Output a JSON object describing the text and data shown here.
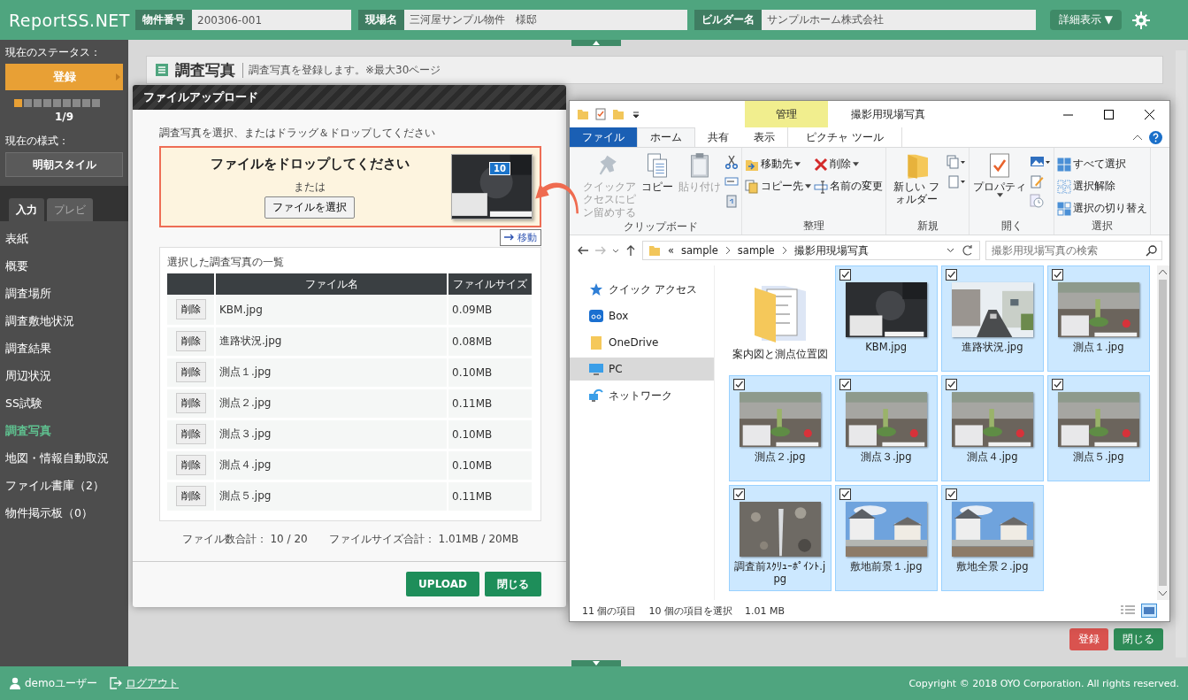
{
  "header": {
    "logo": "ReportSS.NET",
    "fields": [
      {
        "label": "物件番号",
        "value": "200306-001"
      },
      {
        "label": "現場名",
        "value": "三河屋サンプル物件　様邸"
      },
      {
        "label": "ビルダー名",
        "value": "サンプルホーム株式会社"
      }
    ],
    "detail_button": "詳細表示 ▼"
  },
  "sidebar": {
    "status_label": "現在のステータス：",
    "status": "登録",
    "steps": [
      {
        "done": true
      },
      {
        "done": false
      },
      {
        "done": false
      },
      {
        "done": false
      },
      {
        "done": false
      },
      {
        "done": false
      },
      {
        "done": false
      },
      {
        "done": false
      },
      {
        "done": false
      }
    ],
    "step_count": "1/9",
    "style_label": "現在の様式：",
    "style": "明朝スタイル",
    "tabs": [
      {
        "label": "入力",
        "selected": true
      },
      {
        "label": "プレビ",
        "selected": false
      }
    ],
    "items": [
      {
        "label": "表紙",
        "selected": false
      },
      {
        "label": "概要",
        "selected": false
      },
      {
        "label": "調査場所",
        "selected": false
      },
      {
        "label": "調査敷地状況",
        "selected": false
      },
      {
        "label": "調査結果",
        "selected": false
      },
      {
        "label": "周辺状況",
        "selected": false
      },
      {
        "label": "SS試験",
        "selected": false
      },
      {
        "label": "調査写真",
        "selected": true
      },
      {
        "label": "地図・情報自動取況",
        "selected": false
      },
      {
        "label": "ファイル書庫（2）",
        "selected": false
      },
      {
        "label": "物件掲示板（0）",
        "selected": false
      }
    ]
  },
  "page": {
    "title": "調査写真",
    "description": "調査写真を登録します。※最大30ページ",
    "buttons": [
      {
        "label": "登録",
        "kind": "danger"
      },
      {
        "label": "閉じる",
        "kind": "primary"
      }
    ]
  },
  "upload_dialog": {
    "title": "ファイルアップロード",
    "instruction": "調査写真を選択、またはドラッグ＆ドロップしてください",
    "drop_title": "ファイルをドロップしてください",
    "or": "または",
    "choose_button": "ファイルを選択",
    "drag_count": "10",
    "drag_hint": "移動",
    "list_title": "選択した調査写真の一覧",
    "columns": [
      "ファイル名",
      "ファイルサイズ"
    ],
    "rows": [
      {
        "action": "削除",
        "name": "KBM.jpg",
        "size": "0.09MB"
      },
      {
        "action": "削除",
        "name": "進路状況.jpg",
        "size": "0.08MB"
      },
      {
        "action": "削除",
        "name": "測点１.jpg",
        "size": "0.10MB"
      },
      {
        "action": "削除",
        "name": "測点２.jpg",
        "size": "0.11MB"
      },
      {
        "action": "削除",
        "name": "測点３.jpg",
        "size": "0.10MB"
      },
      {
        "action": "削除",
        "name": "測点４.jpg",
        "size": "0.10MB"
      },
      {
        "action": "削除",
        "name": "測点５.jpg",
        "size": "0.11MB"
      }
    ],
    "count_total": "ファイル数合計： 10 / 20",
    "size_total": "ファイルサイズ合計： 1.01MB / 20MB",
    "buttons": [
      "UPLOAD",
      "閉じる"
    ]
  },
  "explorer": {
    "context_tab": "管理",
    "title": "撮影用現場写真",
    "tabs": [
      {
        "label": "ファイル",
        "kind": "file",
        "selected": false
      },
      {
        "label": "ホーム",
        "kind": "tab",
        "selected": true
      },
      {
        "label": "共有",
        "kind": "tab",
        "selected": false
      },
      {
        "label": "表示",
        "kind": "tab",
        "selected": false
      },
      {
        "label": "ピクチャ ツール",
        "kind": "context",
        "selected": false
      }
    ],
    "groups": [
      {
        "label": "クリップボード",
        "items": [
          {
            "label": "クイックアクセスにピン留めする",
            "kind": "large",
            "disabled": true,
            "dropdown": false
          },
          {
            "label": "コピー",
            "kind": "large",
            "disabled": false,
            "dropdown": false
          },
          {
            "label": "貼り付け",
            "kind": "large",
            "disabled": true,
            "dropdown": false
          }
        ]
      },
      {
        "label": "整理",
        "items": [
          {
            "label": "移動先",
            "kind": "small",
            "disabled": false,
            "dropdown": true
          },
          {
            "label": "コピー先",
            "kind": "small",
            "disabled": false,
            "dropdown": true
          },
          {
            "label": "削除",
            "kind": "small",
            "disabled": false,
            "dropdown": true
          },
          {
            "label": "名前の変更",
            "kind": "small",
            "disabled": false,
            "dropdown": false
          }
        ]
      },
      {
        "label": "新規",
        "items": [
          {
            "label": "新しい フォルダー",
            "kind": "large",
            "disabled": false,
            "dropdown": false
          }
        ]
      },
      {
        "label": "開く",
        "items": [
          {
            "label": "プロパティ",
            "kind": "large",
            "disabled": false,
            "dropdown": true
          }
        ]
      },
      {
        "label": "選択",
        "items": [
          {
            "label": "すべて選択",
            "kind": "small",
            "disabled": false,
            "dropdown": false
          },
          {
            "label": "選択解除",
            "kind": "small",
            "disabled": false,
            "dropdown": false
          },
          {
            "label": "選択の切り替え",
            "kind": "small",
            "disabled": false,
            "dropdown": false
          }
        ]
      }
    ],
    "path_prefix": "«",
    "path": [
      "sample",
      "sample",
      "撮影用現場写真"
    ],
    "search_placeholder": "撮影用現場写真の検索",
    "nav": [
      {
        "label": "クイック アクセス",
        "selected": false
      },
      {
        "label": "Box",
        "selected": false
      },
      {
        "label": "OneDrive",
        "selected": false
      },
      {
        "label": "PC",
        "selected": true
      },
      {
        "label": "ネットワーク",
        "selected": false
      }
    ],
    "files": [
      {
        "name": "案内図と測点位置図",
        "kind": "folder",
        "selected": false
      },
      {
        "name": "KBM.jpg",
        "kind": "picture",
        "selected": true
      },
      {
        "name": "進路状況.jpg",
        "kind": "picture",
        "selected": true
      },
      {
        "name": "測点１.jpg",
        "kind": "picture",
        "selected": true
      },
      {
        "name": "測点２.jpg",
        "kind": "picture",
        "selected": true
      },
      {
        "name": "測点３.jpg",
        "kind": "picture",
        "selected": true
      },
      {
        "name": "測点４.jpg",
        "kind": "picture",
        "selected": true
      },
      {
        "name": "測点５.jpg",
        "kind": "picture",
        "selected": true
      },
      {
        "name": "調査前ｽｸﾘｭｰﾎﾟｲﾝﾄ.jpg",
        "kind": "picture",
        "selected": true
      },
      {
        "name": "敷地前景１.jpg",
        "kind": "picture",
        "selected": true
      },
      {
        "name": "敷地全景２.jpg",
        "kind": "picture",
        "selected": true
      }
    ],
    "status": {
      "count": "11 個の項目",
      "selection": "10 個の項目を選択",
      "size": "1.01 MB"
    }
  },
  "footer": {
    "user": "demoユーザー",
    "logout": "ログアウト",
    "copyright": "Copyright © 2018 OYO Corporation. All rights reserved."
  }
}
